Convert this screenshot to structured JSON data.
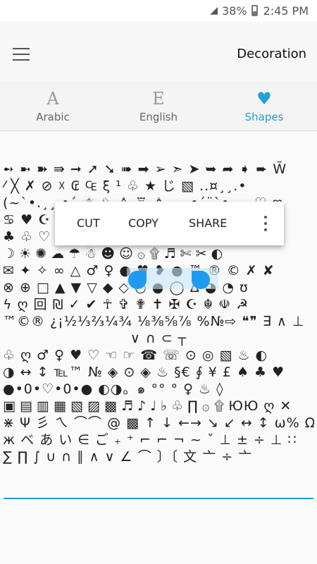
{
  "status": {
    "battery": "38%",
    "time": "2:45 PM"
  },
  "appbar": {
    "title": "Decoration"
  },
  "tabs": [
    {
      "glyph": "A",
      "label": "Arabic"
    },
    {
      "glyph": "E",
      "label": "English"
    },
    {
      "glyph": "♥",
      "label": "Shapes"
    }
  ],
  "context_menu": {
    "cut": "CUT",
    "copy": "COPY",
    "share": "SHARE"
  },
  "symbol_rows": [
    "➻ ➼ ➽ ⇛ ➞ ➚ ➘ ➠ ➡ ➢ ➣ ➤ ➥ ➦ ➧ ➨ W̃",
    "⁄ ╳ ✗ ⊘ ☓ ₢ ₠ ξ ¹ ♧ ★ じ ▧ ..¤¸¸.•",
    "(~`•.¸¸.•´ ☃ ♘ ♙ ♖ ♗ ¸¸.•´¨`•.¸¸ ♡ ღ",
    "♋ ♥          ☪ ☮ ☯ Ω ♤",
    "♣ ♧ ♡ ♦    ♢ ♤ ☽ ☼ ☾ ☾",
    "☽ ☀ ✺ ☁ ☂ ☃ ☻ ☺ ۞ ۩ ♬ ✄ ✂ ◐",
    "✉ ✦ ✧ ∞ △ ♂ ♀ ● ♥ ❥ ● ™ ® © ✗ ✘",
    "⊗ ⊕ □ ▲ ▼ ▽ ◆ ◇ ○ ● ◯ Δ ◕ ◔ ʊ",
    "ϟ ღ 回 ₪ ✓ ✔ ☥ ✞ ✟ ✝ ✠ ☪ ☬ ☫ ☭",
    "™©® ¿¡½⅓⅔¼¾ ⅛⅜⅝⅞ %№⇨ ❝❞ ∃ ∧ ⊥",
    "∨ ∩ ⊂ ┬",
    "♧ ღ ♂ ♀ ♥ ♡ ☜ ☞ ☎ ☏ ⊙ ◎ ▧ ♨ ◐",
    "◑ ↔ ↕ ℡™ № ◈ ⊙ ◈ ♨ §€ ∮ ¥ £ ♠ ♣ ♥",
    "●•0•♡•0•● ◐◑。๑ °° ° ♀ ♨ ◊",
    "▣ ▤ ▥ ▦ ▧ ▨ ▩ ♬ ♪ ♩ ♭ ♧ ∏ ۞ ۩ ЮЮ ღ ✕",
    "⋇ Ψ 彡 ㄟ ⌒⌒ @ ▩ ↑ ↓ ←→ ↘ ↙ ↔ ↕ ω% Ω",
    "ж べ あ い ∈ ご ₊ ⁺ ⌐ ⌐ ¬ ~ ˇ ⊥ ± ÷ ⊥ ∷",
    "∑ ∏ ∫ ∪ ∩ ∥ ∧ ∨ ∠ ⌒ 〕〔 文 亠 ÷ 亠"
  ]
}
